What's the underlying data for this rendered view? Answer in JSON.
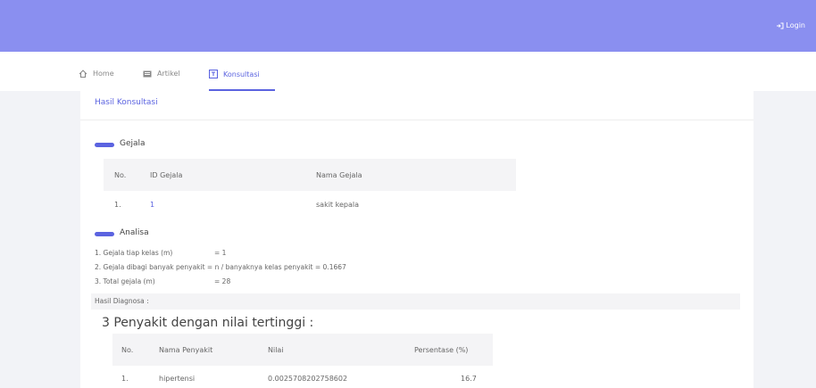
{
  "header": {
    "login_label": "Login"
  },
  "nav": {
    "items": [
      {
        "label": "Home",
        "icon": "home-icon"
      },
      {
        "label": "Artikel",
        "icon": "newspaper-icon"
      },
      {
        "label": "Konsultasi",
        "icon": "consult-icon",
        "active": true
      }
    ]
  },
  "card": {
    "title": "Hasil Konsultasi"
  },
  "gejala": {
    "title": "Gejala",
    "headers": [
      "No.",
      "ID Gejala",
      "Nama Gejala"
    ],
    "rows": [
      {
        "no": "1.",
        "id": "1",
        "nama": "sakit kepala"
      }
    ]
  },
  "analisa": {
    "title": "Analisa",
    "lines": [
      {
        "label": "1. Gejala tiap kelas (m)",
        "value": "= 1"
      },
      {
        "label": "2. Gejala dibagi banyak penyakit = n / banyaknya kelas penyakit = 0.1667",
        "value": ""
      },
      {
        "label": "3. Total gejala (m)",
        "value": "= 28"
      }
    ],
    "hasil_label": "Hasil Diagnosa :"
  },
  "penyakit": {
    "title": "3 Penyakit dengan nilai tertinggi :",
    "headers": [
      "No.",
      "Nama Penyakit",
      "Nilai",
      "Persentase (%)"
    ],
    "rows": [
      {
        "no": "1.",
        "nama": "hipertensi",
        "nilai": "0.0025708202758602",
        "persen": "16.7"
      }
    ]
  },
  "colors": {
    "accent": "#5b63e0",
    "topbar": "#8a8ff0"
  }
}
